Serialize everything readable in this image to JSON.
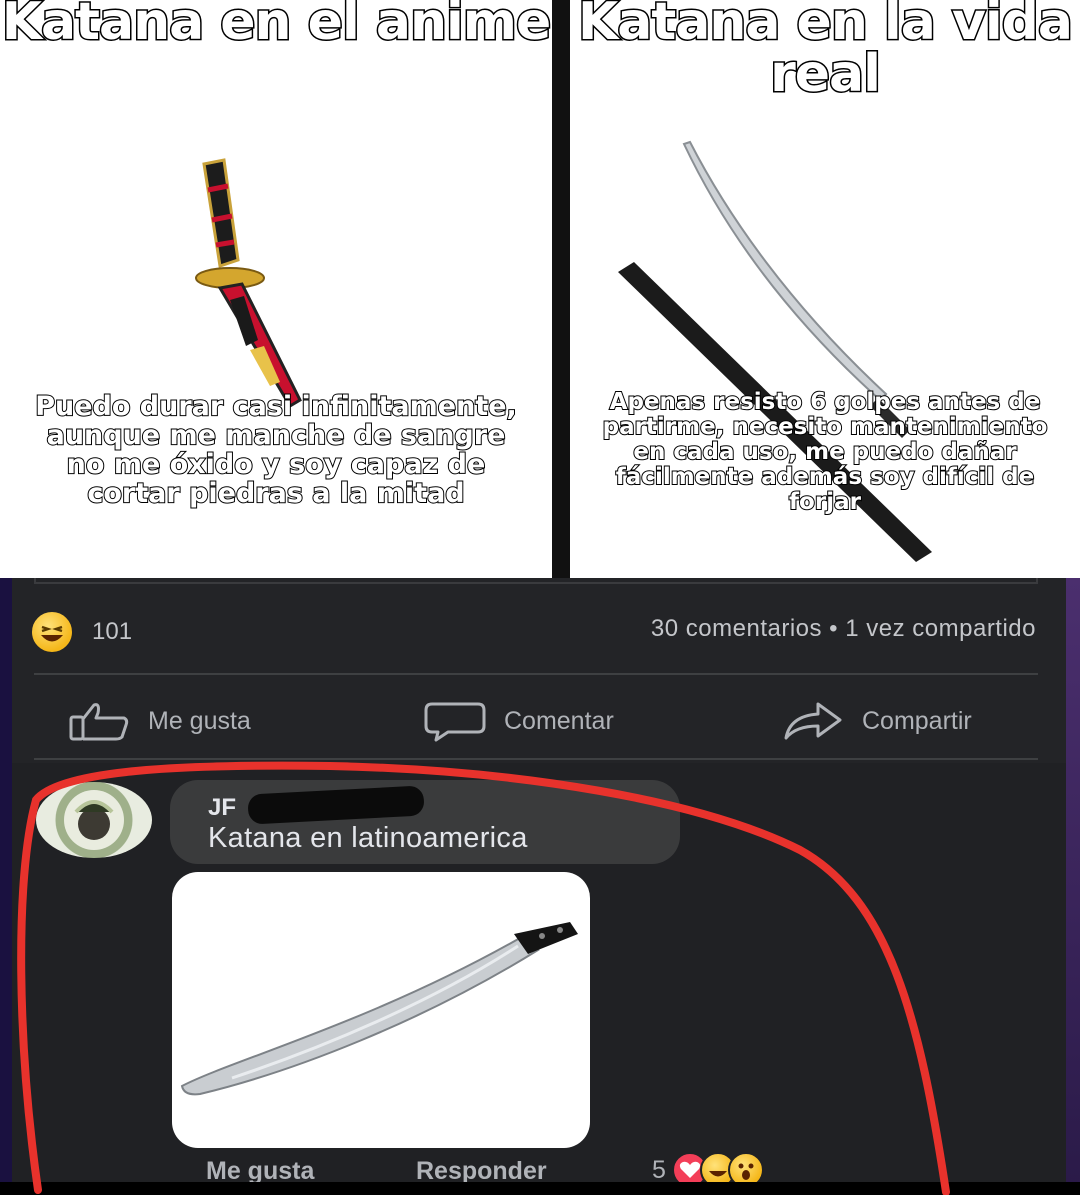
{
  "meme": {
    "left_title": "Katana en el anime",
    "left_caption": "Puedo durar casi infinitamente, aunque me manche de sangre no me óxido y soy capaz de cortar piedras a la mitad",
    "right_title": "Katana en la vida real",
    "right_caption": "Apenas resisto 6 golpes antes de partirme, necesito mantenimiento en cada uso, me puedo dañar fácilmente además soy difícil de forjar"
  },
  "post": {
    "reaction_icon": "haha-emoji-icon",
    "reaction_count": "101",
    "stats": "30 comentarios • 1 vez compartido",
    "actions": {
      "like": "Me gusta",
      "comment": "Comentar",
      "share": "Compartir"
    }
  },
  "comment": {
    "author": "JF",
    "text": "Katana en latinoamerica",
    "photo_icon": "machete-icon",
    "like_label": "Me gusta",
    "reply_label": "Responder",
    "reaction_count": "5",
    "reaction_icons": [
      "heart-icon",
      "haha-icon",
      "wow-icon"
    ]
  },
  "colors": {
    "background": "#18191a",
    "card": "#232427",
    "bubble": "#3a3b3c",
    "text_primary": "#e4e6eb",
    "text_secondary": "#b0b3b8",
    "annotation_red": "#e8322c",
    "love_red": "#f33e58"
  }
}
